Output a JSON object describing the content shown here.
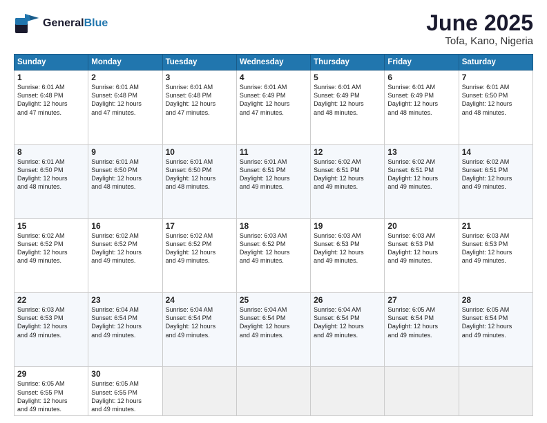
{
  "header": {
    "logo_general": "General",
    "logo_blue": "Blue",
    "month_title": "June 2025",
    "location": "Tofa, Kano, Nigeria"
  },
  "days_of_week": [
    "Sunday",
    "Monday",
    "Tuesday",
    "Wednesday",
    "Thursday",
    "Friday",
    "Saturday"
  ],
  "weeks": [
    [
      {
        "day": 1,
        "sunrise": "6:01 AM",
        "sunset": "6:48 PM",
        "daylight": "12 hours and 47 minutes."
      },
      {
        "day": 2,
        "sunrise": "6:01 AM",
        "sunset": "6:48 PM",
        "daylight": "12 hours and 47 minutes."
      },
      {
        "day": 3,
        "sunrise": "6:01 AM",
        "sunset": "6:48 PM",
        "daylight": "12 hours and 47 minutes."
      },
      {
        "day": 4,
        "sunrise": "6:01 AM",
        "sunset": "6:49 PM",
        "daylight": "12 hours and 47 minutes."
      },
      {
        "day": 5,
        "sunrise": "6:01 AM",
        "sunset": "6:49 PM",
        "daylight": "12 hours and 48 minutes."
      },
      {
        "day": 6,
        "sunrise": "6:01 AM",
        "sunset": "6:49 PM",
        "daylight": "12 hours and 48 minutes."
      },
      {
        "day": 7,
        "sunrise": "6:01 AM",
        "sunset": "6:50 PM",
        "daylight": "12 hours and 48 minutes."
      }
    ],
    [
      {
        "day": 8,
        "sunrise": "6:01 AM",
        "sunset": "6:50 PM",
        "daylight": "12 hours and 48 minutes."
      },
      {
        "day": 9,
        "sunrise": "6:01 AM",
        "sunset": "6:50 PM",
        "daylight": "12 hours and 48 minutes."
      },
      {
        "day": 10,
        "sunrise": "6:01 AM",
        "sunset": "6:50 PM",
        "daylight": "12 hours and 48 minutes."
      },
      {
        "day": 11,
        "sunrise": "6:01 AM",
        "sunset": "6:51 PM",
        "daylight": "12 hours and 49 minutes."
      },
      {
        "day": 12,
        "sunrise": "6:02 AM",
        "sunset": "6:51 PM",
        "daylight": "12 hours and 49 minutes."
      },
      {
        "day": 13,
        "sunrise": "6:02 AM",
        "sunset": "6:51 PM",
        "daylight": "12 hours and 49 minutes."
      },
      {
        "day": 14,
        "sunrise": "6:02 AM",
        "sunset": "6:51 PM",
        "daylight": "12 hours and 49 minutes."
      }
    ],
    [
      {
        "day": 15,
        "sunrise": "6:02 AM",
        "sunset": "6:52 PM",
        "daylight": "12 hours and 49 minutes."
      },
      {
        "day": 16,
        "sunrise": "6:02 AM",
        "sunset": "6:52 PM",
        "daylight": "12 hours and 49 minutes."
      },
      {
        "day": 17,
        "sunrise": "6:02 AM",
        "sunset": "6:52 PM",
        "daylight": "12 hours and 49 minutes."
      },
      {
        "day": 18,
        "sunrise": "6:03 AM",
        "sunset": "6:52 PM",
        "daylight": "12 hours and 49 minutes."
      },
      {
        "day": 19,
        "sunrise": "6:03 AM",
        "sunset": "6:53 PM",
        "daylight": "12 hours and 49 minutes."
      },
      {
        "day": 20,
        "sunrise": "6:03 AM",
        "sunset": "6:53 PM",
        "daylight": "12 hours and 49 minutes."
      },
      {
        "day": 21,
        "sunrise": "6:03 AM",
        "sunset": "6:53 PM",
        "daylight": "12 hours and 49 minutes."
      }
    ],
    [
      {
        "day": 22,
        "sunrise": "6:03 AM",
        "sunset": "6:53 PM",
        "daylight": "12 hours and 49 minutes."
      },
      {
        "day": 23,
        "sunrise": "6:04 AM",
        "sunset": "6:54 PM",
        "daylight": "12 hours and 49 minutes."
      },
      {
        "day": 24,
        "sunrise": "6:04 AM",
        "sunset": "6:54 PM",
        "daylight": "12 hours and 49 minutes."
      },
      {
        "day": 25,
        "sunrise": "6:04 AM",
        "sunset": "6:54 PM",
        "daylight": "12 hours and 49 minutes."
      },
      {
        "day": 26,
        "sunrise": "6:04 AM",
        "sunset": "6:54 PM",
        "daylight": "12 hours and 49 minutes."
      },
      {
        "day": 27,
        "sunrise": "6:05 AM",
        "sunset": "6:54 PM",
        "daylight": "12 hours and 49 minutes."
      },
      {
        "day": 28,
        "sunrise": "6:05 AM",
        "sunset": "6:54 PM",
        "daylight": "12 hours and 49 minutes."
      }
    ],
    [
      {
        "day": 29,
        "sunrise": "6:05 AM",
        "sunset": "6:55 PM",
        "daylight": "12 hours and 49 minutes."
      },
      {
        "day": 30,
        "sunrise": "6:05 AM",
        "sunset": "6:55 PM",
        "daylight": "12 hours and 49 minutes."
      },
      null,
      null,
      null,
      null,
      null
    ]
  ],
  "labels": {
    "sunrise": "Sunrise:",
    "sunset": "Sunset:",
    "daylight": "Daylight:"
  }
}
